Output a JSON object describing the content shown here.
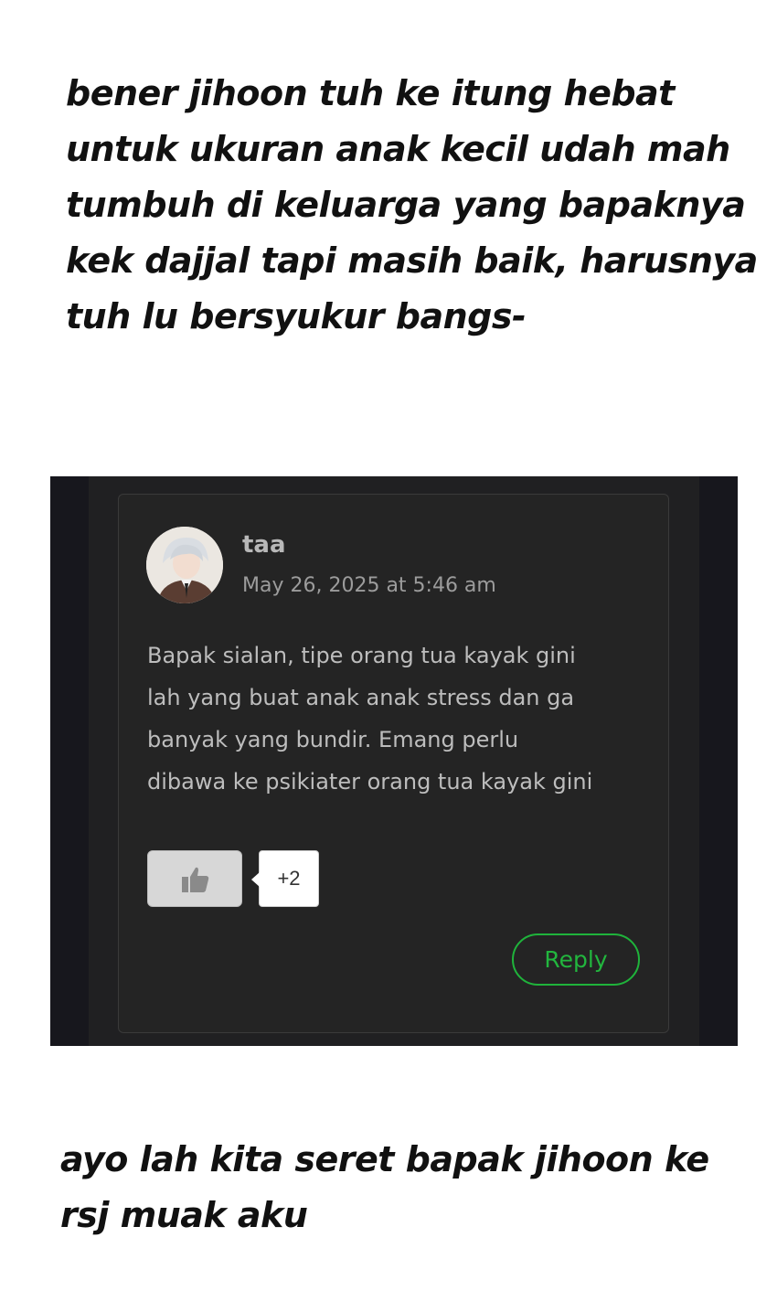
{
  "caption_top": {
    "lines": [
      "bener jihoon tuh ke itung hebat",
      "untuk ukuran anak kecil udah mah",
      "tumbuh di keluarga yang bapaknya",
      "kek dajjal tapi masih baik, harusnya",
      "tuh lu bersyukur bangs-"
    ]
  },
  "comment": {
    "author": "taa",
    "date": "May 26, 2025 at 5:46 am",
    "body_lines": [
      "Bapak sialan, tipe orang tua kayak gini",
      "lah yang buat anak anak stress dan ga",
      "banyak yang bundir. Emang perlu",
      "dibawa ke psikiater orang tua kayak gini"
    ],
    "like_icon": "thumbs-up-icon",
    "like_count": "+2",
    "reply_label": "Reply",
    "colors": {
      "background": "#242424",
      "reply_accent": "#22b63e",
      "text": "#bdbdbd"
    }
  },
  "caption_bottom": {
    "lines": [
      "ayo lah kita seret bapak jihoon ke",
      "rsj muak aku"
    ]
  }
}
